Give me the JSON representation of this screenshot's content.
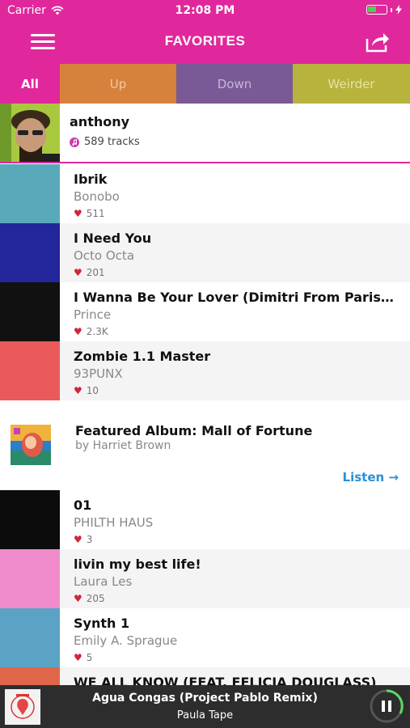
{
  "status": {
    "carrier": "Carrier",
    "time": "12:08 PM"
  },
  "nav": {
    "title": "FAVORITES"
  },
  "tabs": [
    {
      "label": "All"
    },
    {
      "label": "Up"
    },
    {
      "label": "Down"
    },
    {
      "label": "Weirder"
    }
  ],
  "profile": {
    "name": "anthony",
    "tracks": "589 tracks"
  },
  "tracks": [
    {
      "title": "Ibrik",
      "artist": "Bonobo",
      "likes": "511",
      "color": "#5aa9bb"
    },
    {
      "title": "I Need You",
      "artist": "Octo Octa",
      "likes": "201",
      "color": "#22269a"
    },
    {
      "title": "I Wanna Be Your Lover (Dimitri From Paris R...",
      "artist": "Prince",
      "likes": "2.3K",
      "color": "#111111"
    },
    {
      "title": "Zombie 1.1 Master",
      "artist": "93PUNX",
      "likes": "10",
      "color": "#ea5a5a"
    }
  ],
  "featured": {
    "title": "Featured Album: Mall of Fortune",
    "by": "by Harriet Brown",
    "listen": "Listen →"
  },
  "tracks2": [
    {
      "title": "01",
      "artist": "PHILTH HAUS",
      "likes": "3",
      "color": "#0c0c0c"
    },
    {
      "title": "livin my best life!",
      "artist": "Laura Les",
      "likes": "205",
      "color": "#f08ccc"
    },
    {
      "title": "Synth 1",
      "artist": "Emily A. Sprague",
      "likes": "5",
      "color": "#5aa3c4"
    },
    {
      "title": "WE ALL KNOW (FEAT. FELICIA DOUGLASS)",
      "artist": "",
      "likes": "",
      "color": "#e0664a"
    }
  ],
  "player": {
    "title": "Agua Congas (Project Pablo Remix)",
    "artist": "Paula Tape"
  },
  "colors": {
    "brand": "#e0289c",
    "link": "#2a8fd8",
    "heart": "#d0253a"
  }
}
